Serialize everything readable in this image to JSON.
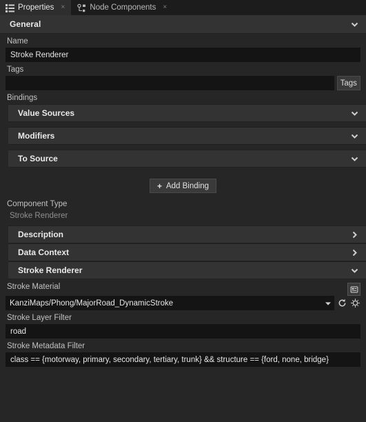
{
  "tabs": [
    {
      "label": "Properties",
      "icon": "list-properties-icon",
      "active": true,
      "close": "×"
    },
    {
      "label": "Node Components",
      "icon": "node-component-icon",
      "active": false,
      "close": "×"
    }
  ],
  "general": {
    "title": "General",
    "name_label": "Name",
    "name_value": "Stroke Renderer",
    "name_placeholder": "",
    "tags_label": "Tags",
    "tags_value": "",
    "tags_placeholder": "",
    "tags_button": "Tags",
    "bindings_label": "Bindings",
    "binding_sections": [
      {
        "label": "Value Sources",
        "state": "expanded"
      },
      {
        "label": "Modifiers",
        "state": "expanded"
      },
      {
        "label": "To Source",
        "state": "expanded"
      }
    ],
    "add_binding_label": "Add Binding",
    "add_binding_plus": "+",
    "component_type_label": "Component Type",
    "component_type_value": "Stroke Renderer"
  },
  "sections": [
    {
      "label": "Description",
      "state": "collapsed"
    },
    {
      "label": "Data Context",
      "state": "collapsed"
    },
    {
      "label": "Stroke Renderer",
      "state": "expanded"
    }
  ],
  "stroke_renderer": {
    "material_label": "Stroke Material",
    "material_value": "KanziMaps/Phong/MajorRoad_DynamicStroke",
    "material_panel_icon": "material-properties-icon",
    "material_reset_icon": "revert-arrow-icon",
    "material_locate_icon": "crosshair-target-icon",
    "layer_filter_label": "Stroke Layer Filter",
    "layer_filter_value": "road",
    "metadata_filter_label": "Stroke Metadata Filter",
    "metadata_filter_value": "class == {motorway, primary, secondary, tertiary, trunk} && structure == {ford, none, bridge}"
  },
  "colors": {
    "window_bg": "#262626",
    "tabbar_bg": "#1c1c1c",
    "tab_active_bg": "#2e2e2e",
    "section_header_bg": "#333333",
    "input_bg": "#141414",
    "button_bg": "#3a3a3a",
    "text": "#d6d6d6",
    "text_dim": "#8f8f8f"
  }
}
